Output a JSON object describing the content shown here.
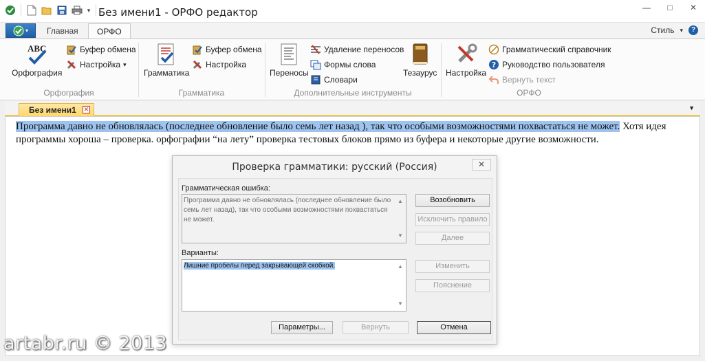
{
  "window": {
    "title": "Без имени1 - ОРФО редактор",
    "controls": {
      "minimize": "—",
      "maximize": "□",
      "close": "✕"
    }
  },
  "ribbon_tabs": {
    "home": "Главная",
    "orfo": "ОРФО",
    "style": "Стиль",
    "style_arrow": "▾"
  },
  "ribbon": {
    "spelling": {
      "big_label": "Орфография",
      "clipboard": "Буфер обмена",
      "settings": "Настройка",
      "group": "Орфография"
    },
    "grammar": {
      "big_label": "Грамматика",
      "clipboard": "Буфер обмена",
      "settings": "Настройка",
      "group": "Грамматика"
    },
    "tools": {
      "hyphenation": "Переносы",
      "remove_hyphens": "Удаление переносов",
      "word_forms": "Формы слова",
      "dictionaries": "Словари",
      "thesaurus": "Тезаурус",
      "group": "Дополнительные инструменты"
    },
    "orfo": {
      "settings": "Настройка",
      "grammar_ref": "Грамматический справочник",
      "user_guide": "Руководство пользователя",
      "return_text": "Вернуть текст",
      "group": "ОРФО"
    }
  },
  "document": {
    "tab_name": "Без имени1",
    "text_selected": "Программа давно не обновлялась (последнее обновление было семь лет назад ), так что особыми возможностями похвастаться не может.",
    "text_rest": " Хотя идея программы хороша – проверка. орфографии “на лету” проверка тестовых блоков прямо из буфера и некоторые другие возможности."
  },
  "dialog": {
    "title": "Проверка грамматики: русский (Россия)",
    "close": "✕",
    "error_label": "Грамматическая ошибка:",
    "error_text_a": "Программа давно не обновлялась (последнее обновление было семь лет назад",
    "error_text_b": "), так что особыми возможностями похвастаться не может.",
    "variants_label": "Варианты:",
    "variant_text": "Лишние пробелы перед закрывающей скобкой.",
    "buttons": {
      "resume": "Возобновить",
      "exclude_rule": "Исключить правило",
      "next": "Далее",
      "change": "Изменить",
      "explain": "Пояснение",
      "params": "Параметры...",
      "undo": "Вернуть",
      "cancel": "Отмена"
    }
  },
  "watermark": "artabr.ru © 2013",
  "colors": {
    "selection": "#9dc3ee",
    "doc_tab": "#ffd86b",
    "accent_blue": "#1f5ea8"
  }
}
